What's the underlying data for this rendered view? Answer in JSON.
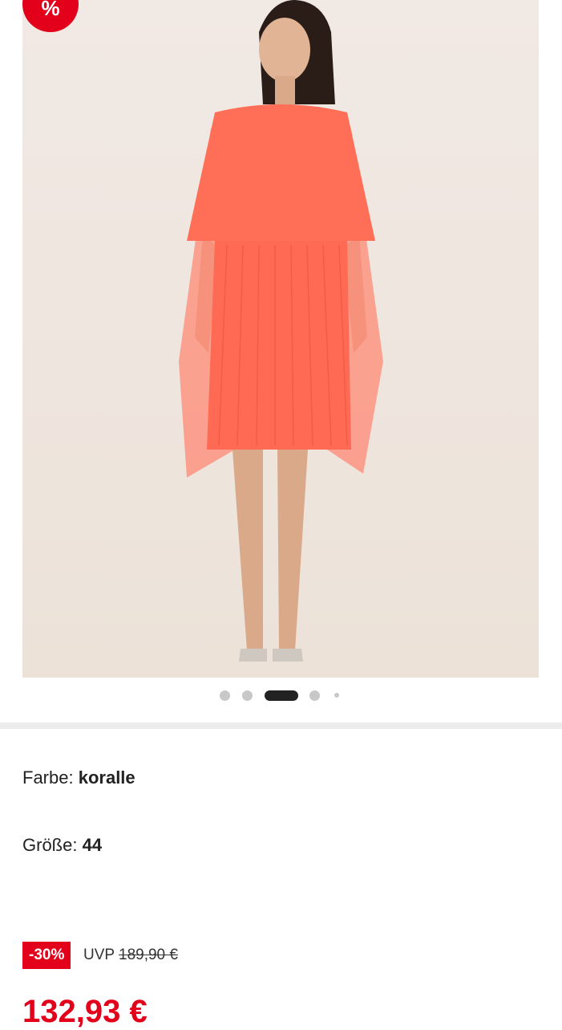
{
  "badge": {
    "icon": "percent",
    "text": "%"
  },
  "gallery": {
    "image_alt": "Model in coral pleated chiffon cape dress",
    "dots_total": 5,
    "active_dot": 2
  },
  "product": {
    "color_label": "Farbe:",
    "color_value": "koralle",
    "size_label": "Größe:",
    "size_value": "44"
  },
  "pricing": {
    "discount": "-30%",
    "uvp_label": "UVP",
    "old_price": "189,90 €",
    "price": "132,93 €"
  },
  "colors": {
    "accent": "#e3001b",
    "dress": "#ff6b55"
  }
}
